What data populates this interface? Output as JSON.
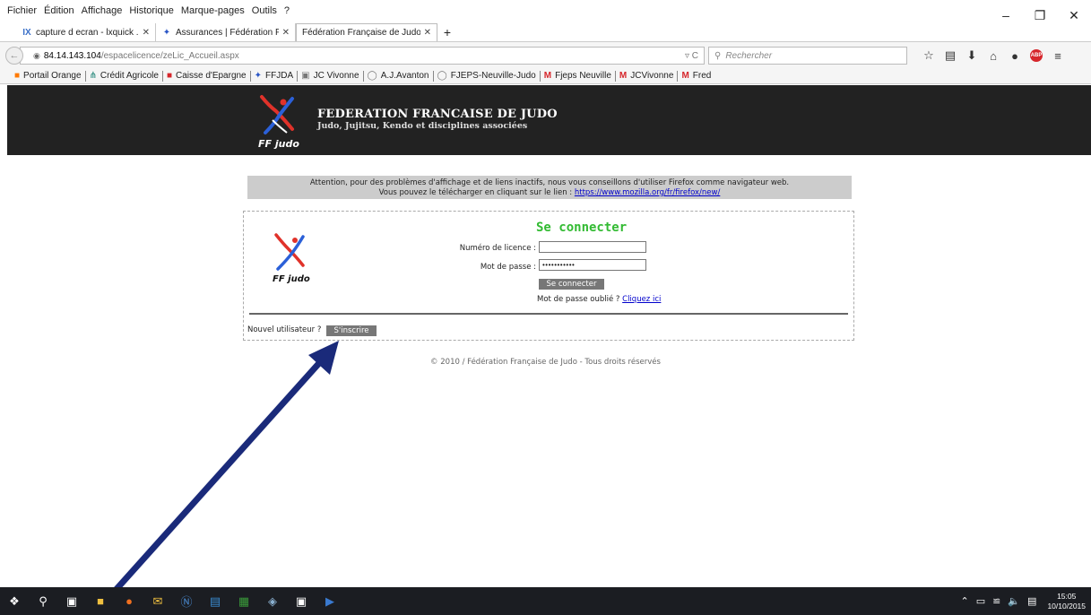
{
  "browser": {
    "menu": [
      {
        "label": "Fichier",
        "u": "F"
      },
      {
        "label": "Édition",
        "u": ""
      },
      {
        "label": "Affichage",
        "u": "A"
      },
      {
        "label": "Historique",
        "u": "H"
      },
      {
        "label": "Marque-pages",
        "u": "M"
      },
      {
        "label": "Outils",
        "u": "O"
      },
      {
        "label": "?",
        "u": "?"
      }
    ],
    "tabs": [
      {
        "title": "capture d ecran - lxquick ...",
        "icon": "ixquick-icon"
      },
      {
        "title": "Assurances | Fédération Fra...",
        "icon": "ffjudo-icon"
      },
      {
        "title": "Fédération Française de Judo",
        "icon": ""
      }
    ],
    "url_host": "84.14.143.104",
    "url_path": "/espacelicence/zeLic_Accueil.aspx",
    "search_placeholder": "Rechercher",
    "bookmarks": [
      "Portail Orange",
      "Crédit Agricole",
      "Caisse d'Epargne",
      "FFJDA",
      "JC Vivonne",
      "A.J.Avanton",
      "FJEPS-Neuville-Judo",
      "Fjeps Neuville",
      "JCVivonne",
      "Fred"
    ]
  },
  "site": {
    "title": "FEDERATION FRANCAISE DE JUDO",
    "subtitle": "Judo, Jujitsu, Kendo et disciplines associées",
    "logo_text": "FF judo"
  },
  "notice": {
    "line1": "Attention, pour des problèmes d'affichage et de liens inactifs, nous vous conseillons d'utiliser Firefox comme navigateur web.",
    "line2_prefix": "Vous pouvez le télécharger en cliquant sur le lien : ",
    "link": "https://www.mozilla.org/fr/firefox/new/"
  },
  "login": {
    "title": "Se connecter",
    "licence_label": "Numéro de licence :",
    "licence_value": "",
    "password_label": "Mot de passe :",
    "password_value": "•••••••••••",
    "submit_label": "Se connecter",
    "forgot_prefix": "Mot de passe oublié ? ",
    "forgot_link": "Cliquez ici",
    "new_user_label": "Nouvel utilisateur ?",
    "register_label": "S'inscrire"
  },
  "footer": {
    "copyright": "© 2010 / Fédération Française de Judo - Tous droits réservés"
  },
  "taskbar": {
    "time": "15:05",
    "date": "10/10/2015"
  },
  "colors": {
    "header_bg": "#222222",
    "title_green": "#33bb33",
    "arrow": "#1a2a7a",
    "button_gray": "#777777"
  }
}
